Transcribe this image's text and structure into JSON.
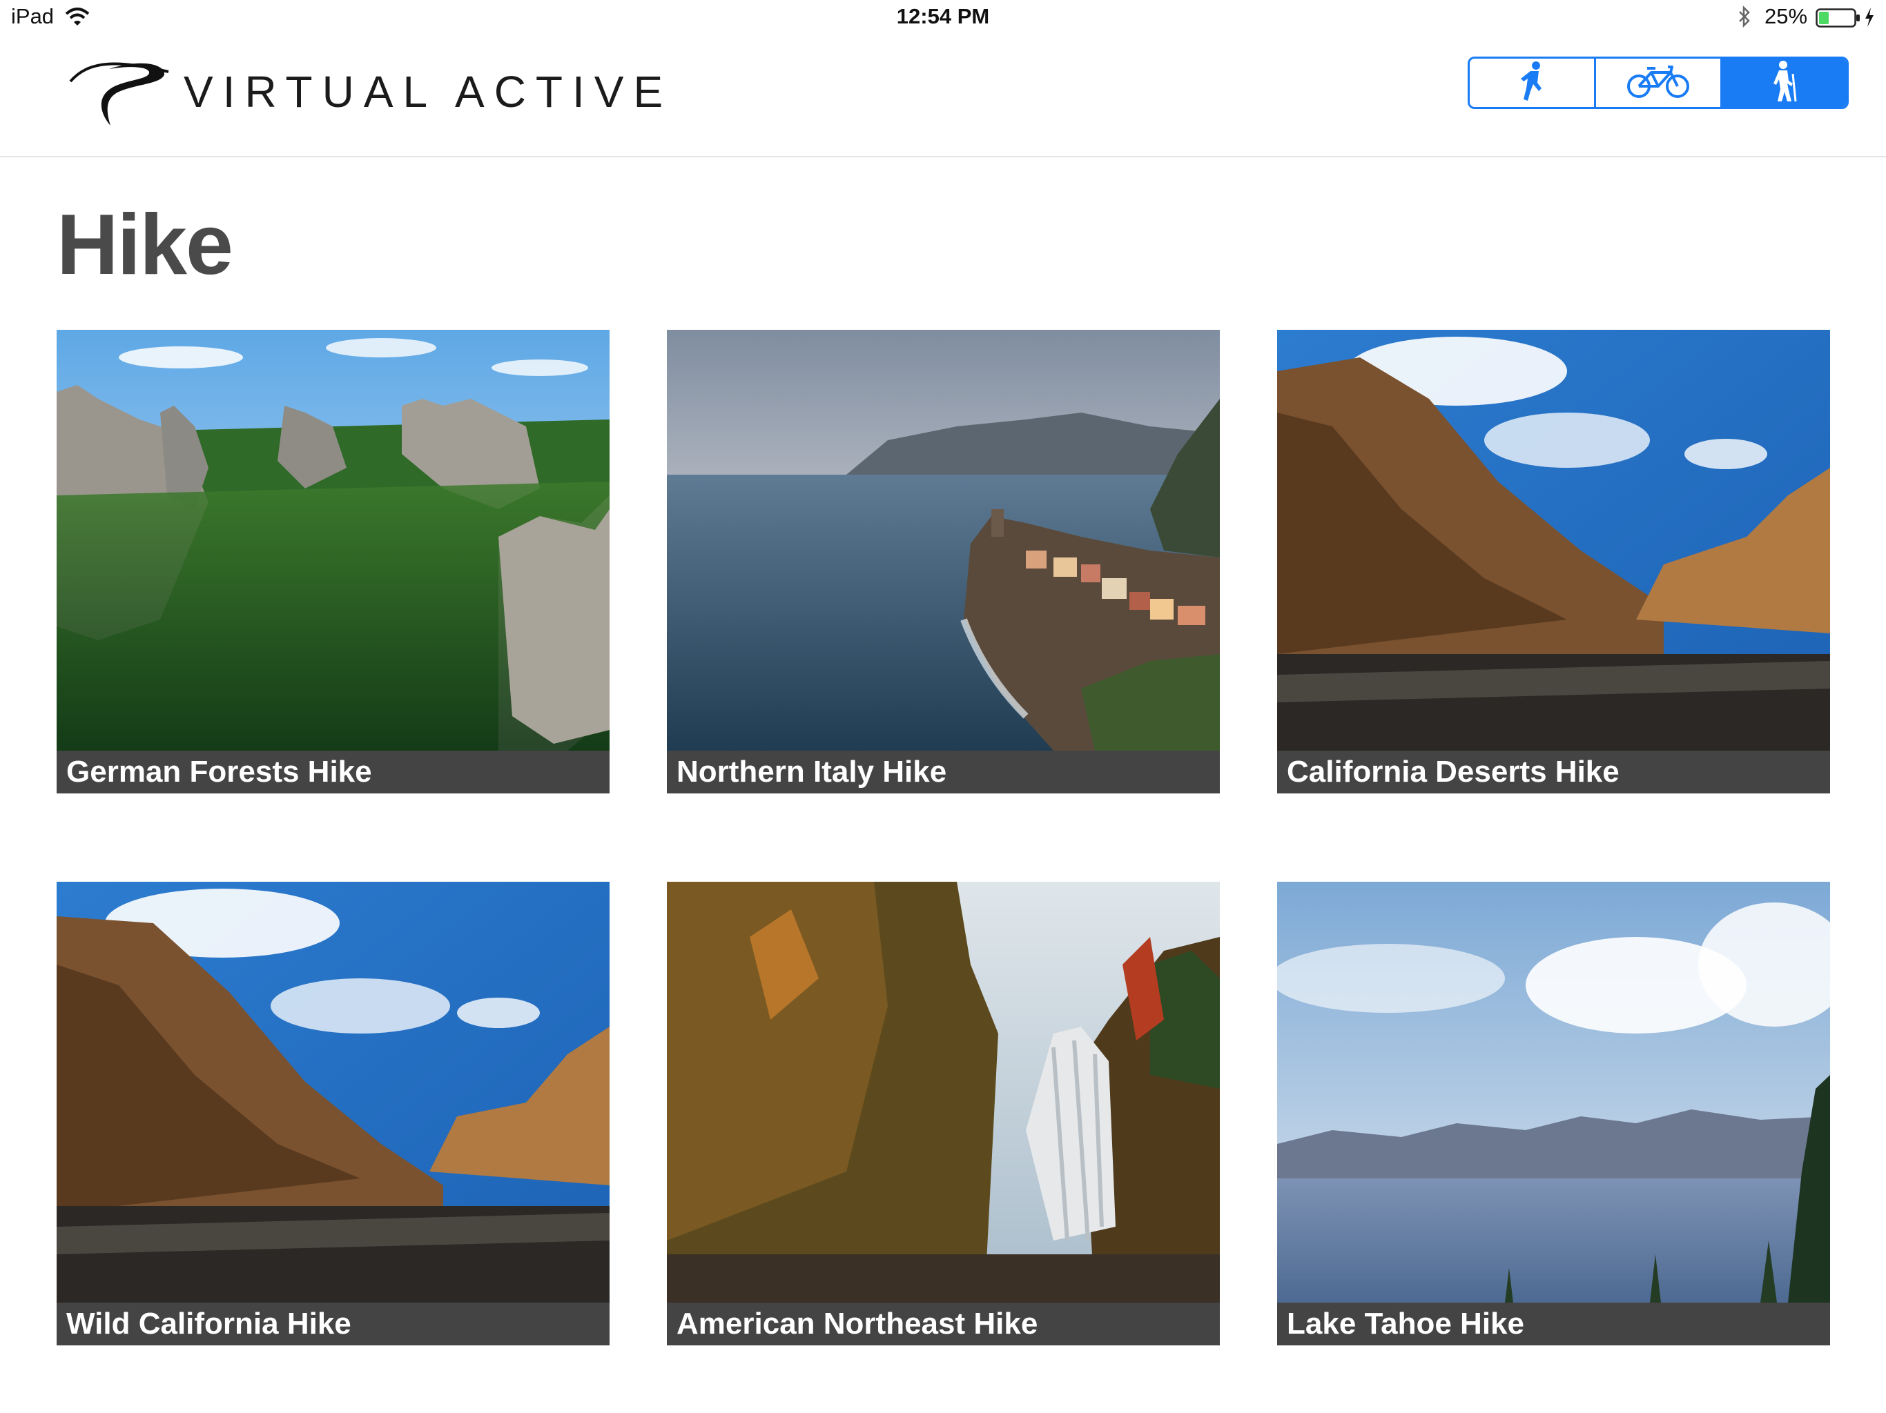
{
  "status_bar": {
    "device": "iPad",
    "time": "12:54 PM",
    "battery": "25%"
  },
  "header": {
    "brand": "VIRTUAL ACTIVE",
    "modes": [
      {
        "icon": "runner-icon",
        "active": false
      },
      {
        "icon": "bicycle-icon",
        "active": false
      },
      {
        "icon": "hiker-icon",
        "active": true
      }
    ],
    "accent_color": "#1a7cf5"
  },
  "page": {
    "title": "Hike"
  },
  "routes": [
    {
      "name": "German Forests Hike",
      "thumbnail": "sandstone-forest-image"
    },
    {
      "name": "Northern Italy Hike",
      "thumbnail": "coastal-village-image"
    },
    {
      "name": "California Deserts Hike",
      "thumbnail": "desert-canyon-image"
    },
    {
      "name": "Wild California Hike",
      "thumbnail": "desert-canyon-image"
    },
    {
      "name": "American Northeast Hike",
      "thumbnail": "autumn-waterfall-image"
    },
    {
      "name": "Lake Tahoe Hike",
      "thumbnail": "mountain-lake-image"
    }
  ]
}
